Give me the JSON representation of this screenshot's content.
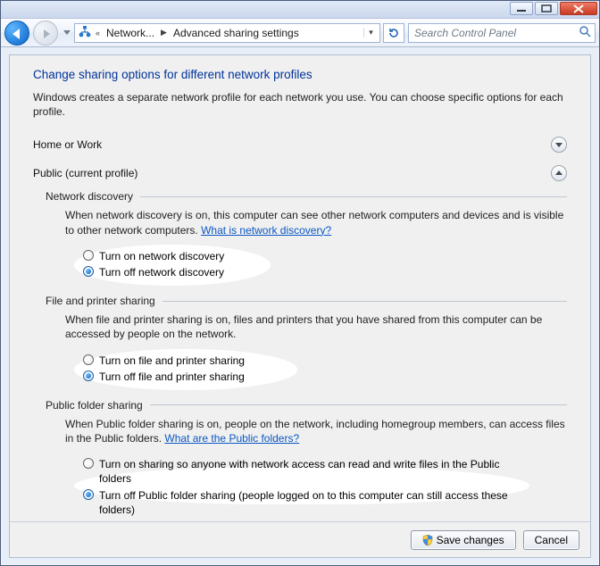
{
  "titleBar": {},
  "nav": {
    "crumb1": "Network...",
    "crumb2": "Advanced sharing settings",
    "searchPlaceholder": "Search Control Panel"
  },
  "page": {
    "heading": "Change sharing options for different network profiles",
    "intro": "Windows creates a separate network profile for each network you use. You can choose specific options for each profile."
  },
  "profiles": {
    "homeWork": {
      "label": "Home or Work",
      "expanded": false
    },
    "public": {
      "label": "Public (current profile)",
      "expanded": true
    }
  },
  "groups": {
    "netdisc": {
      "title": "Network discovery",
      "desc": "When network discovery is on, this computer can see other network computers and devices and is visible to other network computers. ",
      "link": "What is network discovery?",
      "optOn": "Turn on network discovery",
      "optOff": "Turn off network discovery"
    },
    "fps": {
      "title": "File and printer sharing",
      "desc": "When file and printer sharing is on, files and printers that you have shared from this computer can be accessed by people on the network.",
      "optOn": "Turn on file and printer sharing",
      "optOff": "Turn off file and printer sharing"
    },
    "pub": {
      "title": "Public folder sharing",
      "desc": "When Public folder sharing is on, people on the network, including homegroup members, can access files in the Public folders. ",
      "link": "What are the Public folders?",
      "optOn": "Turn on sharing so anyone with network access can read and write files in the Public folders",
      "optOff": "Turn off Public folder sharing (people logged on to this computer can still access these folders)"
    }
  },
  "footer": {
    "save": "Save changes",
    "cancel": "Cancel"
  }
}
